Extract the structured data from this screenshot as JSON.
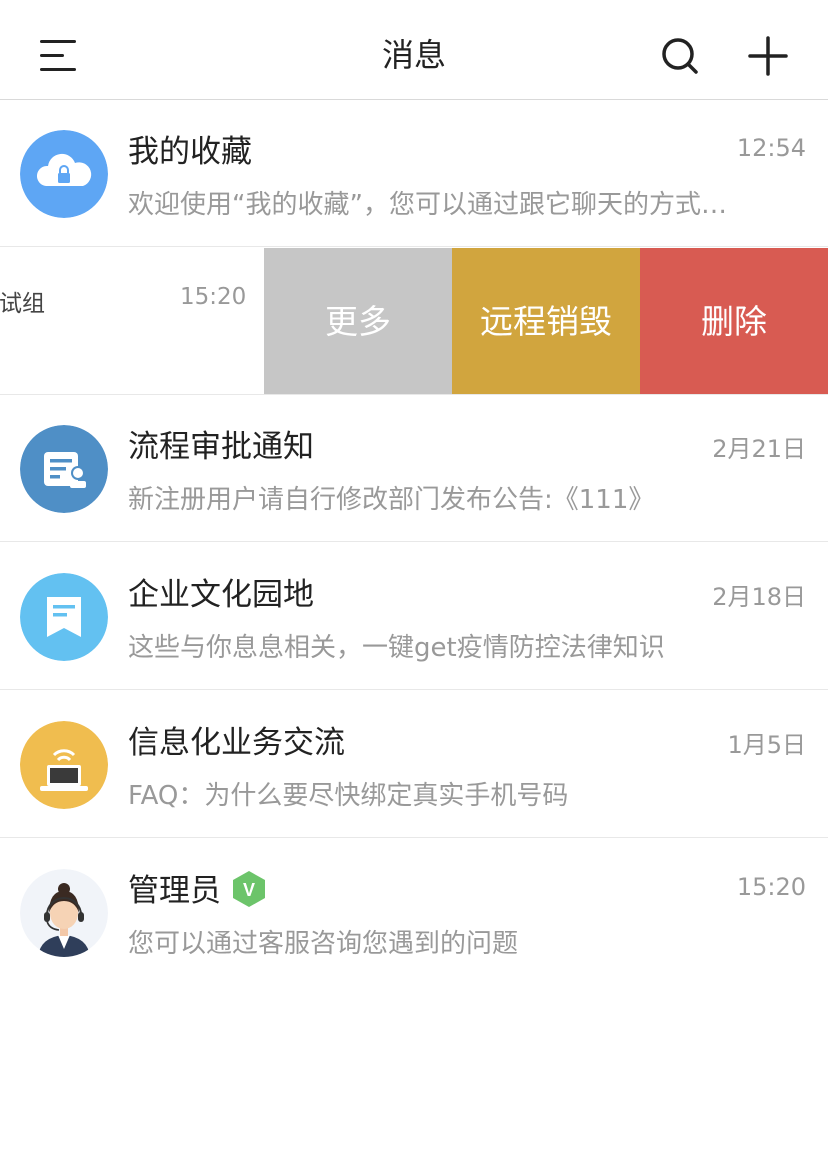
{
  "header": {
    "title": "消息",
    "menu_icon": "menu-icon",
    "search_icon": "search-icon",
    "add_icon": "plus-icon"
  },
  "conversations": [
    {
      "name": "我的收藏",
      "time": "12:54",
      "preview": "欢迎使用“我的收藏”，您可以通过跟它聊天的方式…",
      "icon": "cloud-lock-icon",
      "color": "#5ea6f4"
    },
    {
      "name": "测试组",
      "name_visible": "测试组",
      "time": "15:20",
      "swiped": true
    },
    {
      "name": "流程审批通知",
      "time": "2月21日",
      "preview": "新注册用户请自行修改部门发布公告:《111》",
      "icon": "approval-form-icon",
      "color": "#4f8fc6"
    },
    {
      "name": "企业文化园地",
      "time": "2月18日",
      "preview": "这些与你息息相关，一键get疫情防控法律知识",
      "icon": "bookmark-doc-icon",
      "color": "#63c1f1"
    },
    {
      "name": "信息化业务交流",
      "time": "1月5日",
      "preview": "FAQ：为什么要尽快绑定真实手机号码",
      "icon": "laptop-wifi-icon",
      "color": "#f0bd4f"
    },
    {
      "name": "管理员",
      "time": "15:20",
      "preview": "您可以通过客服咨询您遇到的问题",
      "icon": "agent-avatar-icon",
      "verified_badge": "V"
    }
  ],
  "swipe_actions": {
    "more": "更多",
    "remote_wipe": "远程销毁",
    "delete": "删除"
  },
  "colors": {
    "more_bg": "#c6c6c6",
    "wipe_bg": "#d1a53e",
    "delete_bg": "#d85b52",
    "badge_green": "#6cc46a"
  }
}
